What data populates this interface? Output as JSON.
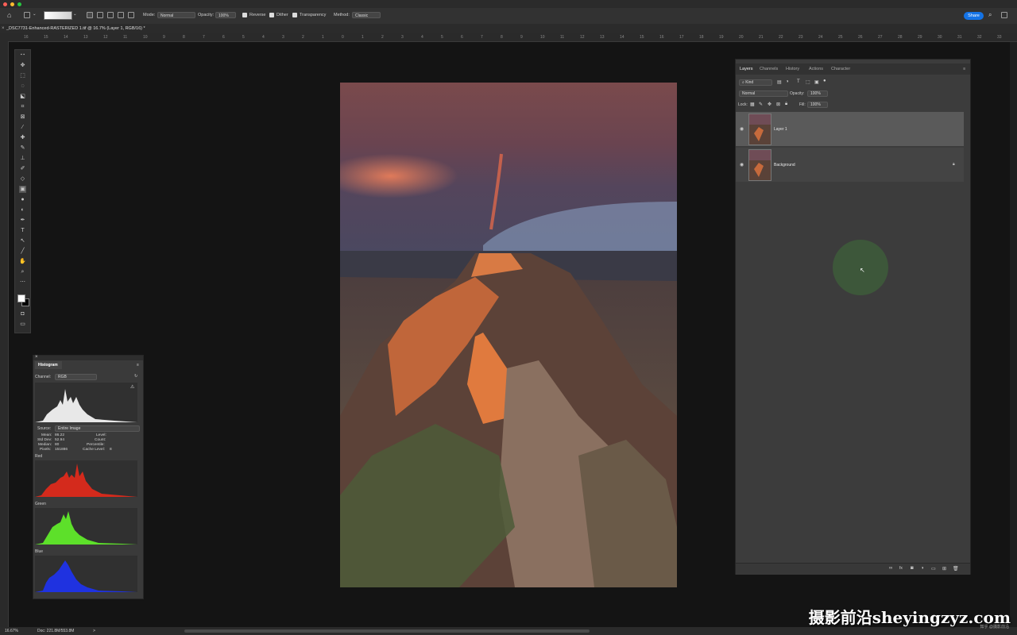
{
  "colors": {
    "accent": "#1473e6",
    "panel": "#3c3c3c",
    "canvas": "#141414",
    "brush_cursor": "#3d5a3a"
  },
  "options_bar": {
    "mode_label": "Mode:",
    "mode_value": "Normal",
    "opacity_label": "Opacity:",
    "opacity_value": "100%",
    "reverse_label": "Reverse",
    "dither_label": "Dither",
    "transparency_label": "Transparency",
    "method_label": "Method:",
    "method_value": "Classic",
    "share_label": "Share"
  },
  "document": {
    "tab_title": "_DSC7731-Enhanced-RASTERIZED 1.tif @ 16.7% (Layer 1, RGB/16) *"
  },
  "ruler_h": [
    "16",
    "15",
    "14",
    "13",
    "12",
    "11",
    "10",
    "9",
    "8",
    "7",
    "6",
    "5",
    "4",
    "3",
    "2",
    "1",
    "0",
    "1",
    "2",
    "3",
    "4",
    "5",
    "6",
    "7",
    "8",
    "9",
    "10",
    "11",
    "12",
    "13",
    "14",
    "15",
    "16",
    "17",
    "18",
    "19",
    "20",
    "21",
    "22",
    "23",
    "24",
    "25",
    "26",
    "27",
    "28",
    "29",
    "30",
    "31",
    "32",
    "33"
  ],
  "layers_panel": {
    "tabs": [
      "Layers",
      "Channels",
      "History",
      "Actions",
      "Character"
    ],
    "filter_kind": "Kind",
    "blend_mode": "Normal",
    "opacity_label": "Opacity:",
    "opacity_value": "100%",
    "lock_label": "Lock:",
    "fill_label": "Fill:",
    "fill_value": "100%",
    "layers": [
      {
        "name": "Layer 1",
        "selected": true
      },
      {
        "name": "Background",
        "locked": true
      }
    ]
  },
  "histogram": {
    "title": "Histogram",
    "channel_label": "Channel:",
    "channel_value": "RGB",
    "source_label": "Source:",
    "source_value": "Entire Image",
    "stats": {
      "mean_label": "Mean:",
      "mean": "86.22",
      "stddev_label": "Std Dev:",
      "stddev": "52.94",
      "median_label": "Median:",
      "median": "80",
      "pixels_label": "Pixels:",
      "pixels": "151886",
      "level_label": "Level:",
      "count_label": "Count:",
      "percentile_label": "Percentile:",
      "cache_label": "Cache Level:",
      "cache": "8"
    },
    "channels": [
      "Red",
      "Green",
      "Blue"
    ]
  },
  "status_bar": {
    "zoom": "16.67%",
    "doc": "Doc: 221.8M/553.8M",
    "arrow": ">"
  },
  "watermark": {
    "text": "摄影前沿sheyingzyz.com",
    "small": "知乎 @摄影前沿"
  }
}
